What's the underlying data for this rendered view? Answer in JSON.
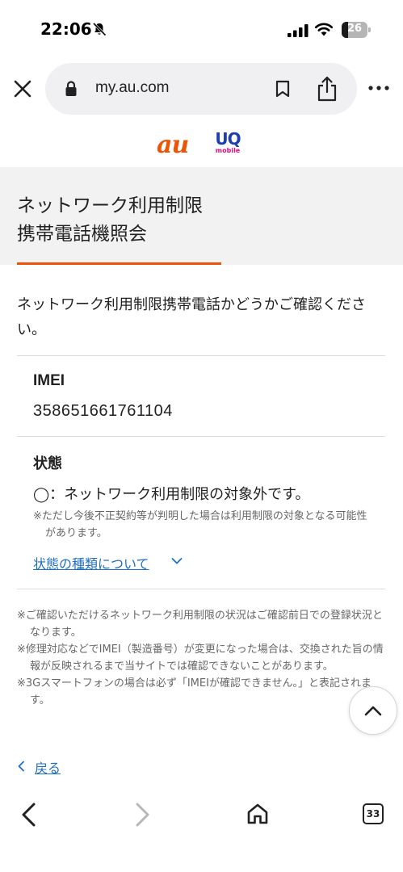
{
  "status_bar": {
    "time": "22:06",
    "battery_level": "26",
    "battery_fraction": 0.26,
    "icons": [
      "bell-slash-icon",
      "cellular-signal-icon",
      "wifi-icon",
      "battery-icon"
    ]
  },
  "browser": {
    "url": "my.au.com",
    "icons": [
      "close-icon",
      "lock-icon",
      "bookmark-icon",
      "share-icon",
      "more-icon"
    ]
  },
  "logos": {
    "au": "au",
    "uq_main": "UQ",
    "uq_sub": "mobile",
    "au_color": "#eb5505",
    "uq_color": "#1e3fb0",
    "uq_sub_color": "#e40b7e"
  },
  "page": {
    "title_line1": "ネットワーク利用制限",
    "title_line2": "携帯電話機照会",
    "accent_color": "#eb5505",
    "intro": "ネットワーク利用制限携帯電話かどうかご確認ください。"
  },
  "imei": {
    "label": "IMEI",
    "value": "358651661761104"
  },
  "status": {
    "label": "状態",
    "value": "◯：ネットワーク利用制限の対象外です。",
    "note": "※ただし今後不正契約等が判明した場合は利用制限の対象となる可能性があります。",
    "types_link": "状態の種類について"
  },
  "notes": [
    "※ご確認いただけるネットワーク利用制限の状況はご確認前日での登録状況となります。",
    "※修理対応などでIMEI（製造番号）が変更になった場合は、交換された旨の情報が反映されるまで当サイトでは確認できないことがあります。",
    "※3Gスマートフォンの場合は必ず「IMEIが確認できません。」と表記されます。"
  ],
  "back_link": "戻る",
  "link_color": "#1f6fbf",
  "toolbar": {
    "tab_count": "33",
    "icons": [
      "back-arrow-icon",
      "forward-arrow-icon",
      "home-icon",
      "tabs-icon"
    ]
  }
}
